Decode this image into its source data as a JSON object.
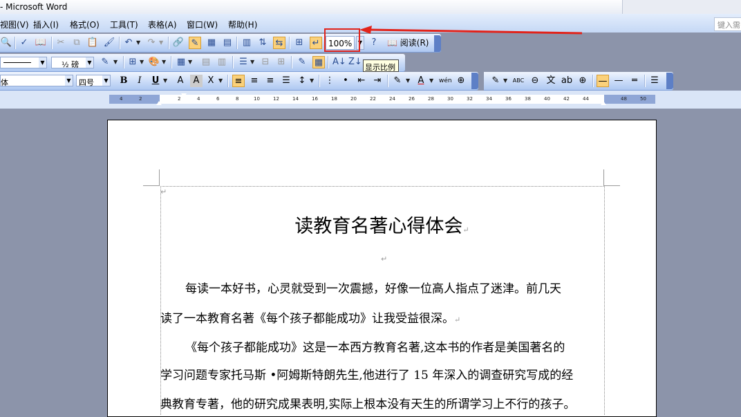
{
  "window": {
    "title": "- Microsoft Word"
  },
  "menubar": {
    "items": [
      "视图(V)",
      "插入(I)",
      "格式(O)",
      "工具(T)",
      "表格(A)",
      "窗口(W)",
      "帮助(H)"
    ],
    "help_placeholder": "键入需"
  },
  "toolbar": {
    "zoom_value": "100%",
    "read_label": "阅读(R)",
    "tooltip": "显示比例",
    "line_spacing_value": "½ 磅",
    "font_name": "体",
    "font_size": "四号"
  },
  "ruler": {
    "ticks": [
      "4",
      "2",
      "2",
      "4",
      "6",
      "8",
      "10",
      "12",
      "14",
      "16",
      "18",
      "20",
      "22",
      "24",
      "26",
      "28",
      "30",
      "32",
      "34",
      "36",
      "38",
      "40",
      "42",
      "44",
      "48",
      "50"
    ]
  },
  "document": {
    "title": "读教育名著心得体会",
    "lines": [
      "每读一本好书，心灵就受到一次震撼，好像一位高人指点了迷津。前几天",
      "读了一本教育名著《每个孩子都能成功》让我受益很深。",
      "《每个孩子都能成功》这是一本西方教育名著,这本书的作者是美国著名的",
      "学习问题专家托马斯 •阿姆斯特朗先生,他进行了 15 年深入的调查研究写成的经",
      "典教育专著，他的研究成果表明,实际上根本没有天生的所谓学习上不行的孩子。"
    ]
  },
  "colors": {
    "annotation": "#e2231a",
    "toolbar_highlight": "#fbd17a"
  }
}
